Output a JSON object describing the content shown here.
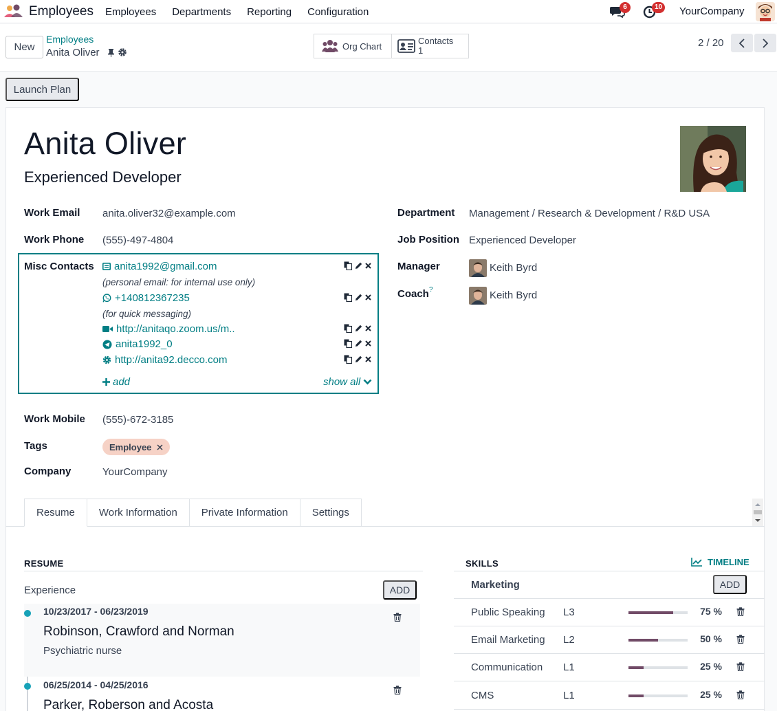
{
  "nav": {
    "app_name": "Employees",
    "menu": [
      "Employees",
      "Departments",
      "Reporting",
      "Configuration"
    ],
    "chat_badge": "6",
    "activity_badge": "10",
    "company": "YourCompany"
  },
  "control": {
    "new_label": "New",
    "breadcrumb_parent": "Employees",
    "breadcrumb_current": "Anita Oliver",
    "org_chart_label": "Org Chart",
    "contacts_label": "Contacts",
    "contacts_count": "1",
    "pager": "2 / 20"
  },
  "launch_plan_label": "Launch Plan",
  "employee": {
    "name": "Anita Oliver",
    "job_title": "Experienced Developer",
    "work_email_label": "Work Email",
    "work_email": "anita.oliver32@example.com",
    "work_phone_label": "Work Phone",
    "work_phone": "(555)-497-4804",
    "misc_label": "Misc Contacts",
    "misc": [
      {
        "icon": "envelope-icon",
        "value": "anita1992@gmail.com",
        "note": "(personal email: for internal use only)"
      },
      {
        "icon": "whatsapp-icon",
        "value": "+140812367235",
        "note": "(for quick messaging)"
      },
      {
        "icon": "video-icon",
        "value": "http://anitaqo.zoom.us/m..",
        "note": ""
      },
      {
        "icon": "telegram-icon",
        "value": "anita1992_0",
        "note": ""
      },
      {
        "icon": "gear-icon",
        "value": "http://anita92.decco.com",
        "note": ""
      }
    ],
    "misc_add": "add",
    "misc_show_all": "show all",
    "work_mobile_label": "Work Mobile",
    "work_mobile": "(555)-672-3185",
    "tags_label": "Tags",
    "tag": "Employee",
    "company_label": "Company",
    "company": "YourCompany",
    "department_label": "Department",
    "department": "Management / Research & Development / R&D USA",
    "job_position_label": "Job Position",
    "job_position": "Experienced Developer",
    "manager_label": "Manager",
    "manager": "Keith Byrd",
    "coach_label": "Coach",
    "coach_help": "?",
    "coach": "Keith Byrd"
  },
  "tabs": [
    "Resume",
    "Work Information",
    "Private Information",
    "Settings"
  ],
  "resume": {
    "header": "RESUME",
    "experience_label": "Experience",
    "add_label": "ADD",
    "entries": [
      {
        "dates": "10/23/2017 - 06/23/2019",
        "title": "Robinson, Crawford and Norman",
        "desc": "Psychiatric nurse"
      },
      {
        "dates": "06/25/2014 - 04/25/2016",
        "title": "Parker, Roberson and Acosta",
        "desc": ""
      }
    ]
  },
  "skills": {
    "header": "SKILLS",
    "timeline_label": "TIMELINE",
    "group": "Marketing",
    "add_label": "ADD",
    "rows": [
      {
        "name": "Public Speaking",
        "level": "L3",
        "percent": 75,
        "percent_label": "75 %"
      },
      {
        "name": "Email Marketing",
        "level": "L2",
        "percent": 50,
        "percent_label": "50 %"
      },
      {
        "name": "Communication",
        "level": "L1",
        "percent": 25,
        "percent_label": "25 %"
      },
      {
        "name": "CMS",
        "level": "L1",
        "percent": 25,
        "percent_label": "25 %"
      }
    ]
  },
  "colors": {
    "accent": "#017e84",
    "brand": "#714b67",
    "badge": "#d32f2f",
    "tag": "#f6d2c6"
  }
}
